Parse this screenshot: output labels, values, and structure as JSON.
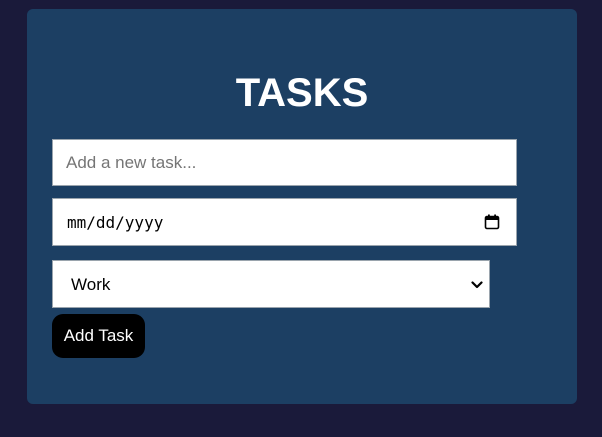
{
  "app": {
    "title": "TASKS"
  },
  "form": {
    "task_input": {
      "placeholder": "Add a new task...",
      "value": ""
    },
    "date_input": {
      "placeholder": "mm/dd/yyyy",
      "value": ""
    },
    "category_select": {
      "selected": "Work"
    },
    "add_button_label": "Add Task"
  },
  "icons": {
    "date": "calendar-icon",
    "select": "chevron-down-icon"
  },
  "colors": {
    "page_background": "#1a1a3a",
    "card_background": "#1c3f63",
    "button_background": "#000000",
    "title_text": "#ffffff"
  }
}
